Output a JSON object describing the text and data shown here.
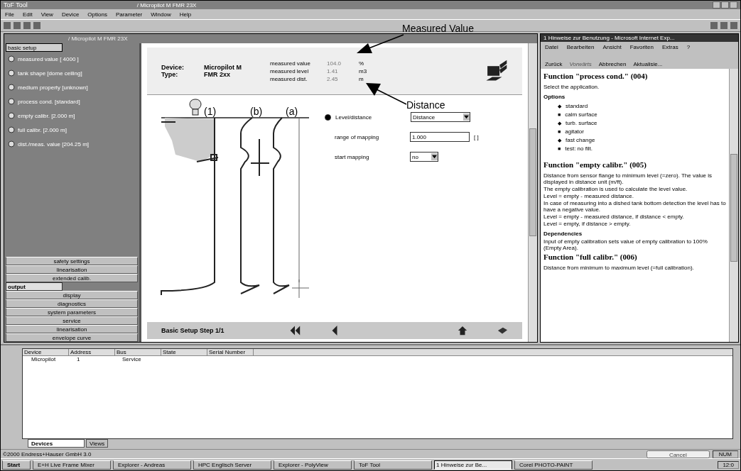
{
  "app": {
    "title": "ToF Tool",
    "document": "/ Micropilot M FMR 23X",
    "menu": [
      "File",
      "Edit",
      "View",
      "Device",
      "Options",
      "Parameter",
      "Window",
      "Help"
    ]
  },
  "child_window": {
    "title": "/ Micropilot M FMR 23X"
  },
  "sidebar": {
    "header": {
      "label": "basic setup",
      "selected": true
    },
    "items": [
      {
        "label": "measured value [ 4000 ]"
      },
      {
        "label": "tank shape [dome ceiling]"
      },
      {
        "label": "medium property [unknown]"
      },
      {
        "label": "process cond. [standard]"
      },
      {
        "label": "empty calibr. [2.000 m]"
      },
      {
        "label": "full calibr. [2.000 m]"
      },
      {
        "label": "dist./meas. value [204.25 m]"
      }
    ],
    "groups": [
      {
        "label": "safety settings",
        "selected": false
      },
      {
        "label": "linearisation",
        "selected": false
      },
      {
        "label": "extended calib.",
        "selected": false
      },
      {
        "label": "output",
        "selected": true
      },
      {
        "label": "display",
        "selected": false
      },
      {
        "label": "diagnostics",
        "selected": false
      },
      {
        "label": "system parameters",
        "selected": false
      },
      {
        "label": "service",
        "selected": false
      },
      {
        "label": "linearisation",
        "selected": false
      },
      {
        "label": "envelope curve",
        "selected": false
      }
    ]
  },
  "device_header": {
    "device_label": "Device:",
    "device": "Micropilot M",
    "type_label": "Type:",
    "type": "FMR 2xx",
    "readings": [
      {
        "label": "measured value",
        "value": "104.0",
        "unit": "%"
      },
      {
        "label": "measured level",
        "value": "1.41",
        "unit": "m3"
      },
      {
        "label": "measured dist.",
        "value": "2.45",
        "unit": "m"
      }
    ]
  },
  "diagram": {
    "labels": [
      "(1)",
      "(b)",
      "(a)"
    ]
  },
  "form": {
    "radio": {
      "label": "Level/distance",
      "checked": true
    },
    "select": "Distance",
    "fields": [
      {
        "label": "range of mapping",
        "value": "1.000",
        "unit": "[ ]"
      }
    ],
    "start": {
      "label": "start mapping",
      "value": "no"
    }
  },
  "step_bar": {
    "label": "Basic Setup Step 1/1"
  },
  "callouts": [
    "Measured Value",
    "Distance"
  ],
  "browser": {
    "title": "1 Hinweise zur Benutzung - Microsoft Internet Exp...",
    "menu": [
      "Datei",
      "Bearbeiten",
      "Ansicht",
      "Favoriten",
      "Extras",
      "?"
    ],
    "toolbar": [
      {
        "label": "Zurück",
        "disabled": false
      },
      {
        "label": "Vorwärts",
        "disabled": true
      },
      {
        "label": "Abbrechen",
        "disabled": false
      },
      {
        "label": "Aktualisie...",
        "disabled": false
      }
    ],
    "sections": [
      {
        "heading": "Function \"process cond.\" (004)",
        "paragraphs": [
          "Select the application."
        ],
        "subheading": "Options",
        "list": [
          {
            "marker": "◆",
            "label": "standard"
          },
          {
            "marker": "■",
            "label": "calm surface"
          },
          {
            "marker": "◆",
            "label": "turb. surface"
          },
          {
            "marker": "■",
            "label": "agitator"
          },
          {
            "marker": "◆",
            "label": "fast change"
          },
          {
            "marker": "■",
            "label": "test: no filt."
          }
        ]
      },
      {
        "heading": "Function \"empty calibr.\" (005)",
        "paragraphs": [
          "Distance from sensor flange to minimum level (=zero). The value is displayed in distance unit (m/ft).",
          "The empty calibration is used to calculate the level value.",
          "Level = empty - measured distance.",
          "In case of measuring into a dished tank bottom detection the level has to have a negative value.",
          "Level = empty - measured distance, if distance < empty.",
          "Level = empty, if distance > empty."
        ],
        "subheading": "Dependencies",
        "notes": [
          "Input of empty calibration sets value of empty calibration to 100% (Empty Area)."
        ]
      },
      {
        "heading": "Function \"full calibr.\" (006)",
        "paragraphs": [
          "Distance from minimum to maximum level (=full calibration)."
        ]
      }
    ]
  },
  "device_list": {
    "columns": [
      "Device",
      "Address",
      "Bus",
      "State",
      "Serial Number"
    ],
    "rows": [
      [
        "Micropilot",
        "1",
        "Service"
      ]
    ],
    "tabs": [
      {
        "label": "Devices",
        "selected": true
      },
      {
        "label": "Views",
        "selected": false
      }
    ]
  },
  "status_bar": {
    "text": "©2000 Endress+Hauser GmbH 3.0",
    "button": "Cancel",
    "mode": "NUM"
  },
  "taskbar": {
    "start": "Start",
    "tasks": [
      {
        "label": "E+H Live Frame Mixer",
        "selected": false
      },
      {
        "label": "Explorer - Andreas",
        "selected": false
      },
      {
        "label": "HPC Englisch Server",
        "selected": false
      },
      {
        "label": "Explorer - PolyView",
        "selected": false
      },
      {
        "label": "ToF Tool",
        "selected": false
      },
      {
        "label": "1 Hinweise zur Be...",
        "selected": true
      },
      {
        "label": "Corel PHOTO-PAINT",
        "selected": false
      }
    ],
    "clock": "12:0"
  }
}
